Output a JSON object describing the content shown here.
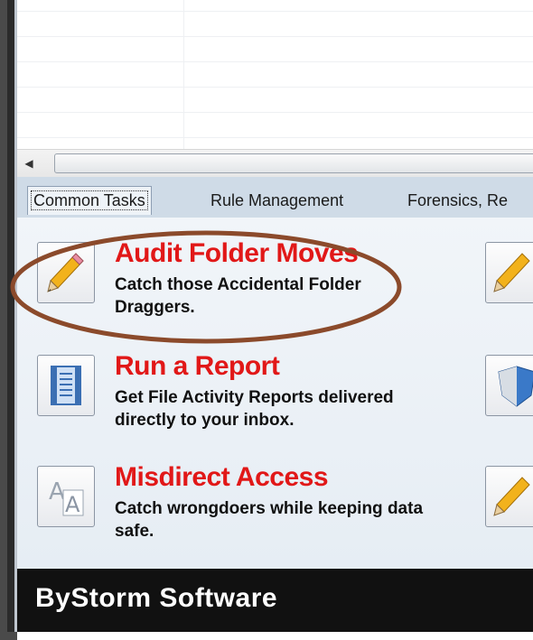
{
  "tabs": [
    {
      "label": "Common Tasks"
    },
    {
      "label": "Rule Management"
    },
    {
      "label": "Forensics, Re"
    }
  ],
  "tasks": [
    {
      "title": "Audit Folder Moves",
      "description": "Catch those Accidental Folder Draggers.",
      "icon": "pencil-icon"
    },
    {
      "title": "Run a Report",
      "description": "Get File Activity Reports delivered directly to your inbox.",
      "icon": "report-icon"
    },
    {
      "title": "Misdirect Access",
      "description": "Catch wrongdoers while keeping data safe.",
      "icon": "font-icon"
    }
  ],
  "right_icons": [
    "pencil-icon",
    "shield-icon",
    "pencil-icon"
  ],
  "footer": {
    "brand": "ByStorm Software"
  },
  "colors": {
    "task_title": "#e11818",
    "highlight_ellipse": "#8b4a2b",
    "footer_bg": "#111111"
  }
}
